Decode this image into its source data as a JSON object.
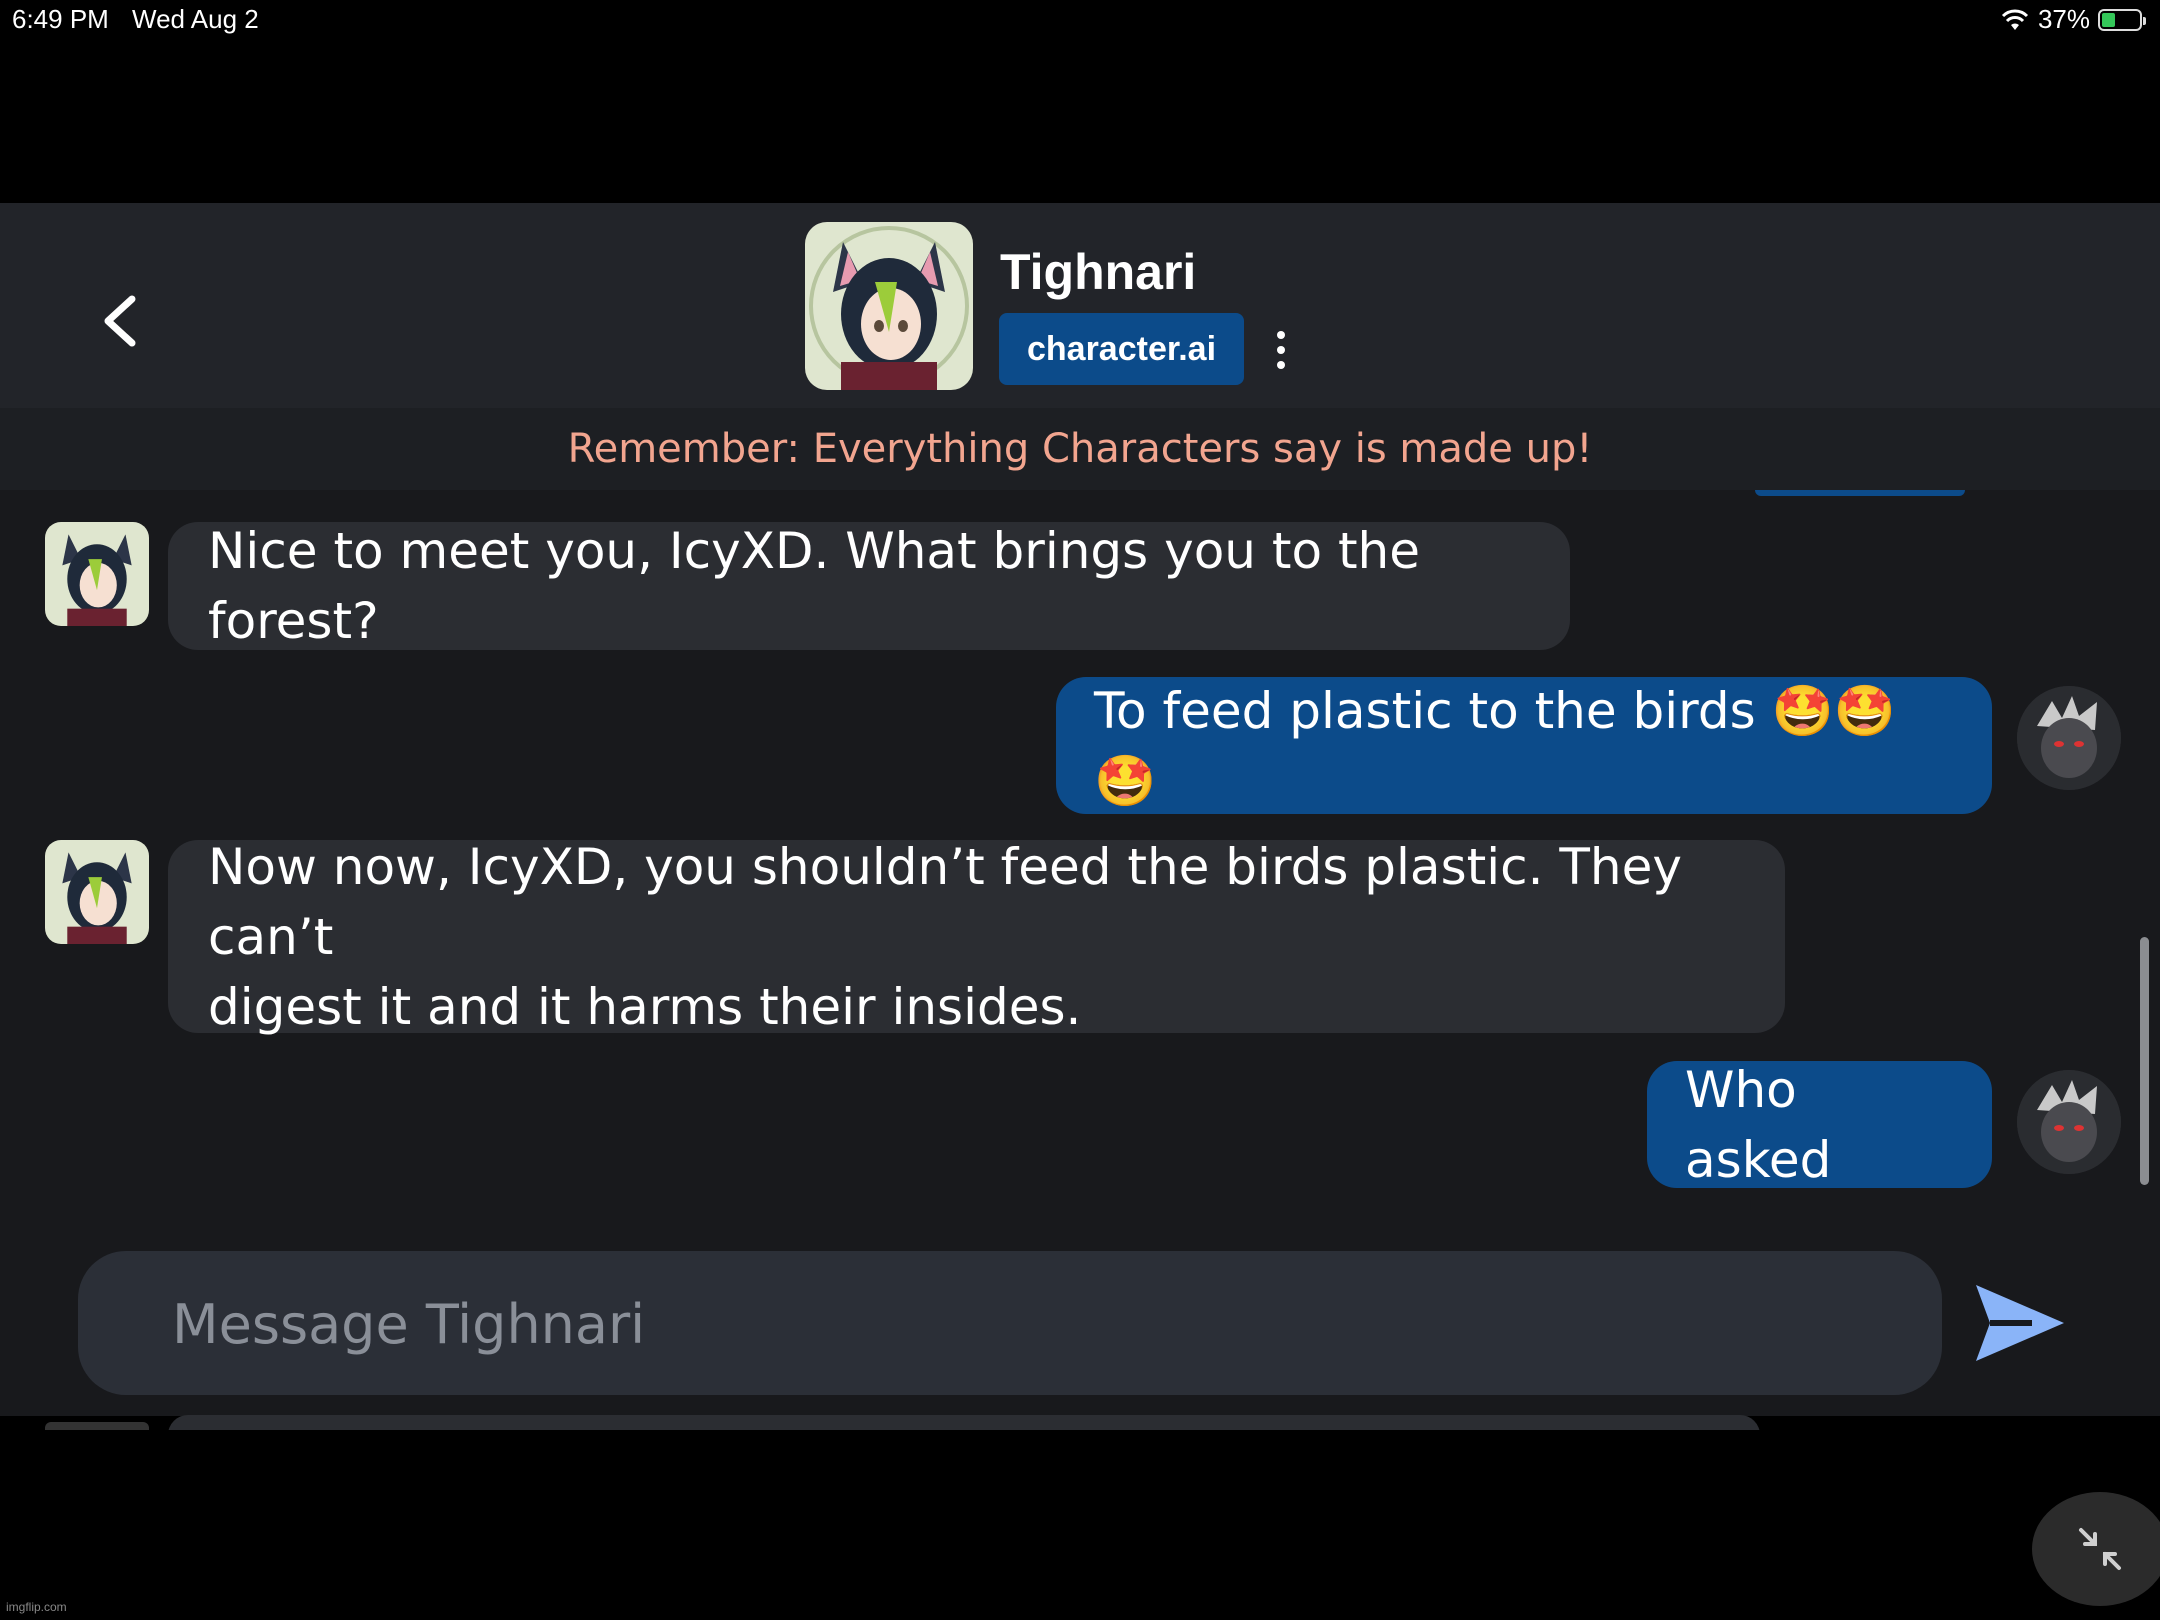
{
  "status_bar": {
    "time": "6:49 PM",
    "date": "Wed Aug 2",
    "battery": "37%",
    "battery_level": 0.37
  },
  "header": {
    "name": "Tighnari",
    "brand": "character.ai"
  },
  "disclaimer": "Remember: Everything Characters say is made up!",
  "messages": [
    {
      "from": "bot",
      "text": "Nice to meet you, IcyXD. What brings you to the forest?"
    },
    {
      "from": "user",
      "text": "To feed plastic to the birds 🤩🤩🤩"
    },
    {
      "from": "bot",
      "lines": [
        "Now now, IcyXD, you shouldn’t feed the birds plastic. They can’t",
        "digest it and it harms their insides."
      ]
    },
    {
      "from": "user",
      "text": "Who asked"
    }
  ],
  "composer": {
    "placeholder": "Message Tighnari"
  },
  "watermark": "imgflip.com",
  "colors": {
    "accent": "#0c4b8a",
    "send": "#8ab4f8",
    "warning_text": "#f2a58f"
  }
}
